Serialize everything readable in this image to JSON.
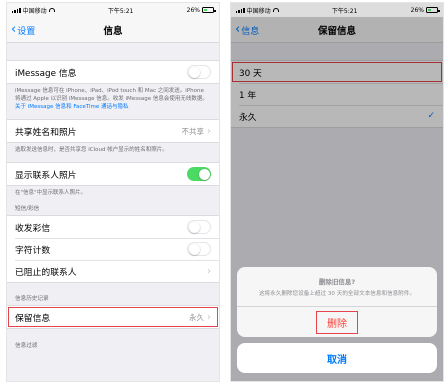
{
  "status": {
    "carrier": "中国移动",
    "time": "下午5:21",
    "battery": "26%"
  },
  "left": {
    "nav": {
      "back_label": "设置",
      "title": "信息"
    },
    "imessage": {
      "label": "iMessage 信息",
      "enabled": false,
      "footnote": "iMessage 信息可在 iPhone、iPad、iPod touch 和 Mac 之间发送。iPhone 将通过 Apple 以识别 iMessage 信息。收发 iMessage 信息会使用无线数据。",
      "link": "关于 iMessage 信息和 FaceTime 通话与隐私"
    },
    "share_name": {
      "label": "共享姓名和照片",
      "value": "不共享",
      "footnote": "选取发送信息时，是否共享您 iCloud 帐户显示的姓名和照片。"
    },
    "contact_photos": {
      "label": "显示联系人照片",
      "enabled": true,
      "footnote": "在\"信息\"中显示联系人照片。"
    },
    "sms_section": {
      "header": "短信/彩信",
      "mms_label": "收发彩信",
      "mms_enabled": false,
      "char_count_label": "字符计数",
      "char_count_enabled": false,
      "blocked_label": "已阻止的联系人"
    },
    "history_section": {
      "header": "信息历史记录",
      "keep_label": "保留信息",
      "keep_value": "永久"
    },
    "filter_header": "信息过滤"
  },
  "right": {
    "nav": {
      "back_label": "信息",
      "title": "保留信息"
    },
    "options": [
      {
        "label": "30 天",
        "checked": false
      },
      {
        "label": "1 年",
        "checked": false
      },
      {
        "label": "永久",
        "checked": true
      }
    ],
    "sheet": {
      "title": "删除旧信息?",
      "message": "这将永久删除您设备上超过 30 天的全部文本信息和信息附件。",
      "delete_label": "删除",
      "cancel_label": "取消"
    }
  },
  "colors": {
    "ios_blue": "#007aff",
    "toggle_green": "#4cd964",
    "destructive_red": "#ff3b30",
    "highlight_red": "#e5454a"
  }
}
